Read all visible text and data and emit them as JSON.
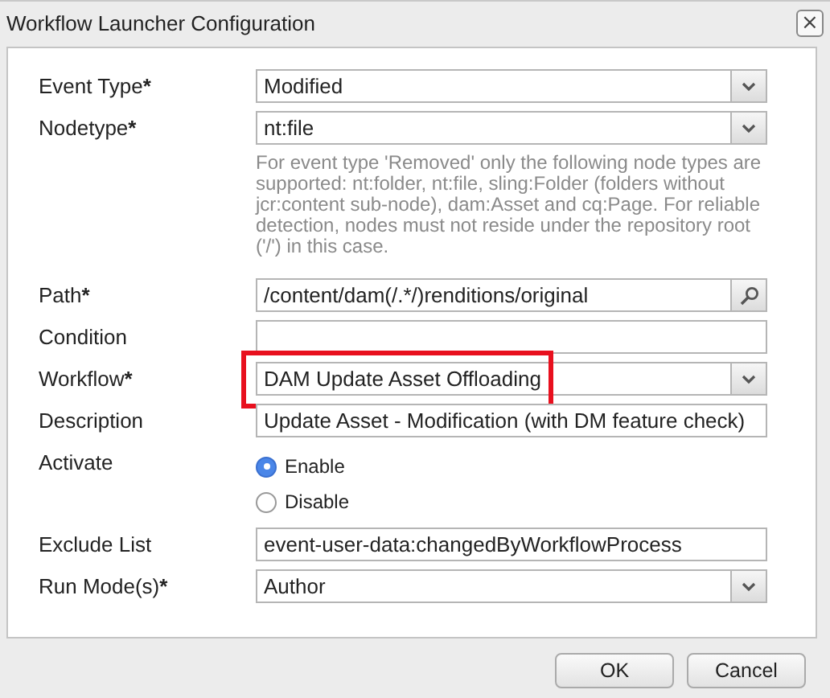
{
  "window": {
    "title": "Workflow Launcher Configuration",
    "close": "×"
  },
  "fields": [
    {
      "kind": "select",
      "label": "Event Type",
      "required_mark": "*",
      "value": "Modified"
    },
    {
      "kind": "select",
      "label": "Nodetype",
      "required_mark": "*",
      "value": "nt:file",
      "hint": "For event type 'Removed' only the following node types are supported: nt:folder, nt:file, sling:Folder (folders without jcr:content sub-node), dam:Asset and cq:Page. For reliable detection, nodes must not reside under the repository root ('/') in this case."
    },
    {
      "kind": "search",
      "label": "Path",
      "required_mark": "*",
      "value": "/content/dam(/.*/)renditions/original"
    },
    {
      "kind": "text",
      "label": "Condition"
    },
    {
      "kind": "select",
      "label": "Workflow",
      "required_mark": "*",
      "value": "DAM Update Asset Offloading",
      "highlighted": true
    },
    {
      "kind": "text",
      "label": "Description",
      "value": "Update Asset - Modification (with DM feature check)"
    },
    {
      "kind": "radio",
      "label": "Activate",
      "options": [
        {
          "label": "Enable",
          "selected": true
        },
        {
          "label": "Disable",
          "selected": false
        }
      ]
    },
    {
      "kind": "text",
      "label": "Exclude List",
      "value": "event-user-data:changedByWorkflowProcess"
    },
    {
      "kind": "select",
      "label": "Run Mode(s)",
      "required_mark": "*",
      "value": "Author"
    }
  ],
  "buttons": [
    "OK",
    "Cancel"
  ]
}
